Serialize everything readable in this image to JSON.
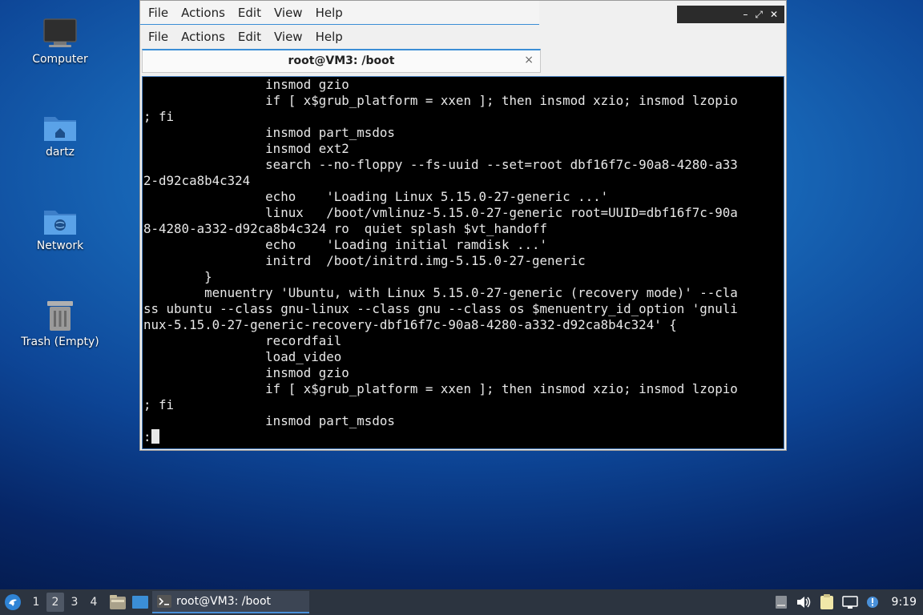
{
  "desktop": {
    "icons": [
      {
        "label": "Computer"
      },
      {
        "label": "dartz"
      },
      {
        "label": "Network"
      },
      {
        "label": "Trash (Empty)"
      }
    ]
  },
  "window": {
    "menu_outer": [
      "File",
      "Actions",
      "Edit",
      "View",
      "Help"
    ],
    "menu_inner": [
      "File",
      "Actions",
      "Edit",
      "View",
      "Help"
    ],
    "controls": {
      "minimize": "–",
      "maximize": "⤢",
      "close": "✕"
    },
    "tab": {
      "title": "root@VM3: /boot",
      "close": "×"
    },
    "terminal_lines": [
      "                insmod gzio",
      "                if [ x$grub_platform = xxen ]; then insmod xzio; insmod lzopio",
      "; fi",
      "                insmod part_msdos",
      "                insmod ext2",
      "                search --no-floppy --fs-uuid --set=root dbf16f7c-90a8-4280-a33",
      "2-d92ca8b4c324",
      "                echo    'Loading Linux 5.15.0-27-generic ...'",
      "                linux   /boot/vmlinuz-5.15.0-27-generic root=UUID=dbf16f7c-90a",
      "8-4280-a332-d92ca8b4c324 ro  quiet splash $vt_handoff",
      "                echo    'Loading initial ramdisk ...'",
      "                initrd  /boot/initrd.img-5.15.0-27-generic",
      "        }",
      "        menuentry 'Ubuntu, with Linux 5.15.0-27-generic (recovery mode)' --cla",
      "ss ubuntu --class gnu-linux --class gnu --class os $menuentry_id_option 'gnuli",
      "nux-5.15.0-27-generic-recovery-dbf16f7c-90a8-4280-a332-d92ca8b4c324' {",
      "                recordfail",
      "                load_video",
      "                insmod gzio",
      "                if [ x$grub_platform = xxen ]; then insmod xzio; insmod lzopio",
      "; fi",
      "                insmod part_msdos"
    ],
    "prompt": ":"
  },
  "taskbar": {
    "workspaces": [
      "1",
      "2",
      "3",
      "4"
    ],
    "active_workspace": "2",
    "task_label": "root@VM3: /boot",
    "clock": "9:19"
  }
}
